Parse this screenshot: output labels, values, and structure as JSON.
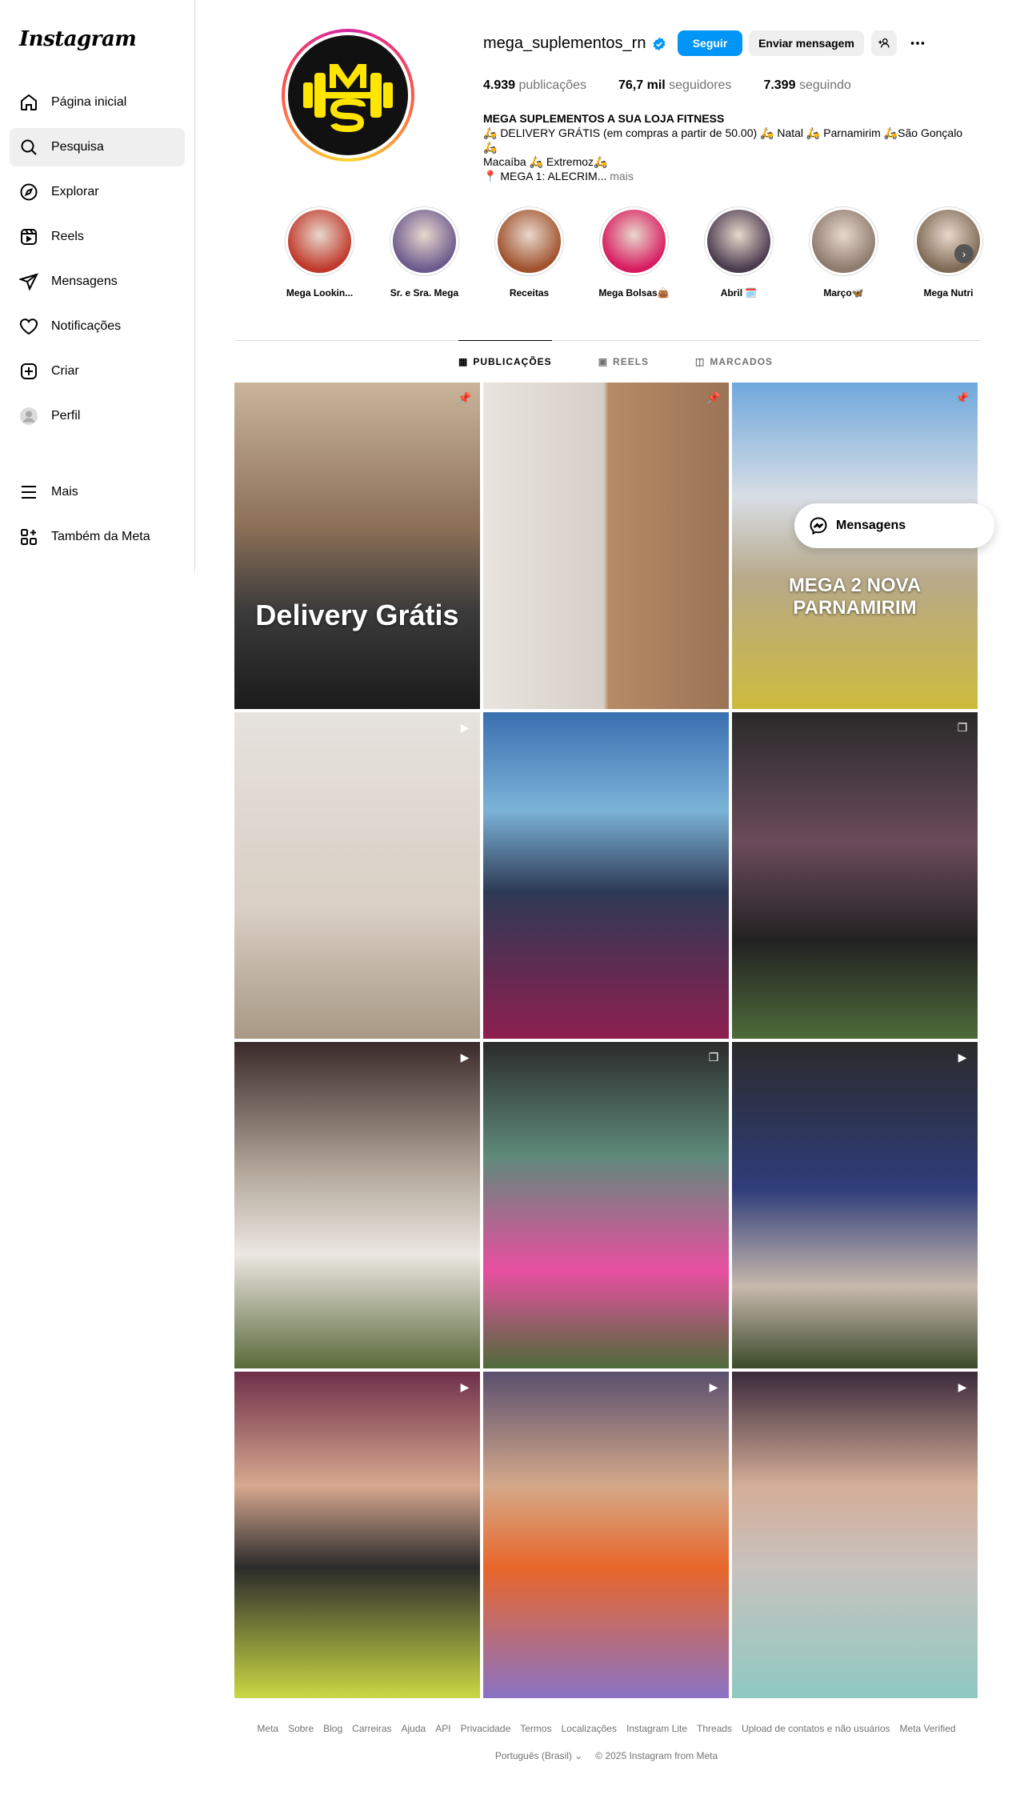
{
  "sidebar": {
    "logo": "Instagram",
    "items": [
      {
        "label": "Página inicial",
        "icon": "home-icon"
      },
      {
        "label": "Pesquisa",
        "icon": "search-icon"
      },
      {
        "label": "Explorar",
        "icon": "compass-icon"
      },
      {
        "label": "Reels",
        "icon": "reels-icon"
      },
      {
        "label": "Mensagens",
        "icon": "send-icon"
      },
      {
        "label": "Notificações",
        "icon": "heart-icon"
      },
      {
        "label": "Criar",
        "icon": "plus-icon"
      },
      {
        "label": "Perfil",
        "icon": "profile-icon"
      }
    ],
    "bottom": [
      {
        "label": "Mais",
        "icon": "menu-icon"
      },
      {
        "label": "Também da Meta",
        "icon": "meta-apps-icon"
      }
    ]
  },
  "profile": {
    "username": "mega_suplementos_rn",
    "follow_label": "Seguir",
    "message_label": "Enviar mensagem",
    "stats": {
      "posts_value": "4.939",
      "posts_label": "publicações",
      "followers_value": "76,7 mil",
      "followers_label": "seguidores",
      "following_value": "7.399",
      "following_label": "seguindo"
    },
    "bio": {
      "title": "MEGA SUPLEMENTOS A SUA LOJA FITNESS",
      "line1": "🛵 DELIVERY GRÁTIS (em compras a partir de 50.00) 🛵 Natal 🛵 Parnamirim 🛵São Gonçalo 🛵",
      "line2": "Macaíba 🛵 Extremoz🛵",
      "line3": "📍 MEGA 1: ALECRIM...",
      "more": "mais"
    }
  },
  "highlights": [
    {
      "label": "Mega Lookin...",
      "color": "#c0392b"
    },
    {
      "label": "Sr. e Sra. Mega",
      "color": "#6c5a8e"
    },
    {
      "label": "Receitas",
      "color": "#a0522d"
    },
    {
      "label": "Mega Bolsas👜",
      "color": "#d81b60"
    },
    {
      "label": "Abril 🗓️",
      "color": "#4a3b4f"
    },
    {
      "label": "Março🦋",
      "color": "#8d7b6e"
    },
    {
      "label": "Mega Nutri",
      "color": "#7f6a55"
    }
  ],
  "tabs": [
    {
      "label": "PUBLICAÇÕES",
      "icon": "grid-icon"
    },
    {
      "label": "REELS",
      "icon": "reels-icon"
    },
    {
      "label": "MARCADOS",
      "icon": "tagged-icon"
    }
  ],
  "posts": [
    {
      "badge": "pin-icon",
      "bg": "linear-gradient(180deg,#c9b49a 0%,#8a6e56 45%,#3b3b3b 70%,#1b1b1b 100%)",
      "caption": "Delivery Grátis"
    },
    {
      "badge": "pin-icon",
      "bg": "linear-gradient(90deg,#e9e4df 0%,#d6cfc7 49%,#b68b64 51%,#9b7357 100%)",
      "caption": ""
    },
    {
      "badge": "pin-icon",
      "bg": "linear-gradient(180deg,#6fa8dc 0%,#d8dee6 35%,#b7a98a 60%,#cdbb3c 100%)",
      "caption": "MEGA 2 NOVA PARNAMIRIM"
    },
    {
      "badge": "reel-icon",
      "bg": "linear-gradient(180deg,#e6e2de 0%,#d9cfc4 60%,#a89884 100%)",
      "caption": ""
    },
    {
      "badge": "",
      "bg": "linear-gradient(180deg,#3a6fb0 0%,#7cb3d8 30%,#2d3a55 55%,#8e1f4f 100%)",
      "caption": ""
    },
    {
      "badge": "carousel-icon",
      "bg": "linear-gradient(180deg,#2a2a2a 0%,#6b4b5b 40%,#222 70%,#4e6b3a 100%)",
      "caption": ""
    },
    {
      "badge": "reel-icon",
      "bg": "linear-gradient(180deg,#3a2a2a 0%,#b3a89a 40%,#ece7e2 65%,#5a6a3a 100%)",
      "caption": ""
    },
    {
      "badge": "carousel-icon",
      "bg": "linear-gradient(180deg,#2b2b2b 0%,#5e8a7a 35%,#e84fa0 70%,#4e6b3a 100%)",
      "caption": ""
    },
    {
      "badge": "reel-icon",
      "bg": "linear-gradient(180deg,#2b2b2b 0%,#2f3d7a 45%,#c8b9ad 75%,#3a4a2a 100%)",
      "caption": ""
    },
    {
      "badge": "reel-icon",
      "bg": "linear-gradient(180deg,#6e2f4a 0%,#d7a88e 35%,#2b2b2b 60%,#c9d844 100%)",
      "caption": ""
    },
    {
      "badge": "reel-icon",
      "bg": "linear-gradient(180deg,#5a4f6e 0%,#d4a98a 35%,#e8662a 60%,#8a73c4 100%)",
      "caption": ""
    },
    {
      "badge": "reel-icon",
      "bg": "linear-gradient(180deg,#3a2a3a 0%,#d4ae98 35%,#c7c2bd 60%,#8fc9c2 100%)",
      "caption": ""
    }
  ],
  "floating": {
    "label": "Mensagens"
  },
  "footer": {
    "links": [
      "Meta",
      "Sobre",
      "Blog",
      "Carreiras",
      "Ajuda",
      "API",
      "Privacidade",
      "Termos",
      "Localizações",
      "Instagram Lite",
      "Threads",
      "Upload de contatos e não usuários",
      "Meta Verified"
    ],
    "language": "Português (Brasil)",
    "copyright": "© 2025 Instagram from Meta"
  }
}
